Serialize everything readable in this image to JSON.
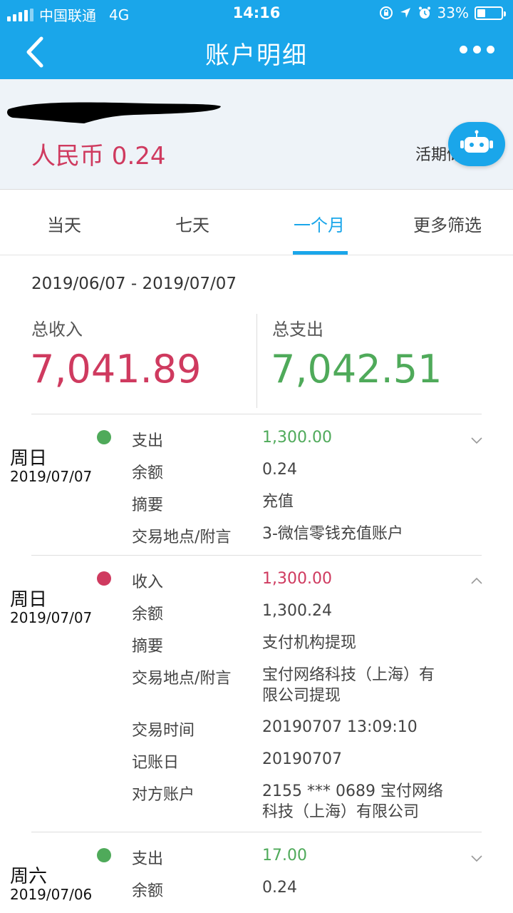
{
  "status_bar": {
    "carrier": "中国联通",
    "network": "4G",
    "time": "14:16",
    "battery": "33%",
    "battery_level": 0.33
  },
  "nav": {
    "title": "账户明细",
    "back_icon": "chevron-left-icon",
    "more_icon": "more-dots-icon"
  },
  "account": {
    "balance_text": "人民币 0.24",
    "type_text": "活期储",
    "assistant_icon": "robot-icon"
  },
  "tabs": [
    {
      "label": "当天",
      "active": false
    },
    {
      "label": "七天",
      "active": false
    },
    {
      "label": "一个月",
      "active": true
    },
    {
      "label": "更多筛选",
      "active": false
    }
  ],
  "summary": {
    "date_range": "2019/06/07 - 2019/07/07",
    "income_label": "总收入",
    "income_value": "7,041.89",
    "expense_label": "总支出",
    "expense_value": "7,042.51"
  },
  "transactions": [
    {
      "day": "周日",
      "date": "2019/07/07",
      "kind": "expense",
      "expanded": false,
      "fields": [
        {
          "label": "支出",
          "value": "1,300.00"
        },
        {
          "label": "余额",
          "value": "0.24"
        },
        {
          "label": "摘要",
          "value": "充值"
        },
        {
          "label": "交易地点/附言",
          "value": "3-微信零钱充值账户"
        }
      ]
    },
    {
      "day": "周日",
      "date": "2019/07/07",
      "kind": "income",
      "expanded": true,
      "fields": [
        {
          "label": "收入",
          "value": "1,300.00"
        },
        {
          "label": "余额",
          "value": "1,300.24"
        },
        {
          "label": "摘要",
          "value": "支付机构提现"
        },
        {
          "label": "交易地点/附言",
          "value": "宝付网络科技（上海）有限公司提现"
        },
        {
          "label": "交易时间",
          "value": "20190707 13:09:10"
        },
        {
          "label": "记账日",
          "value": "20190707"
        },
        {
          "label": "对方账户",
          "value": "2155 *** 0689 宝付网络科技（上海）有限公司"
        }
      ]
    },
    {
      "day": "周六",
      "date": "2019/07/06",
      "kind": "expense",
      "expanded": false,
      "fields": [
        {
          "label": "支出",
          "value": "17.00"
        },
        {
          "label": "余额",
          "value": "0.24"
        }
      ]
    }
  ],
  "colors": {
    "brand": "#1aa6ea",
    "income": "#cf3a5f",
    "expense": "#4faa5a"
  }
}
